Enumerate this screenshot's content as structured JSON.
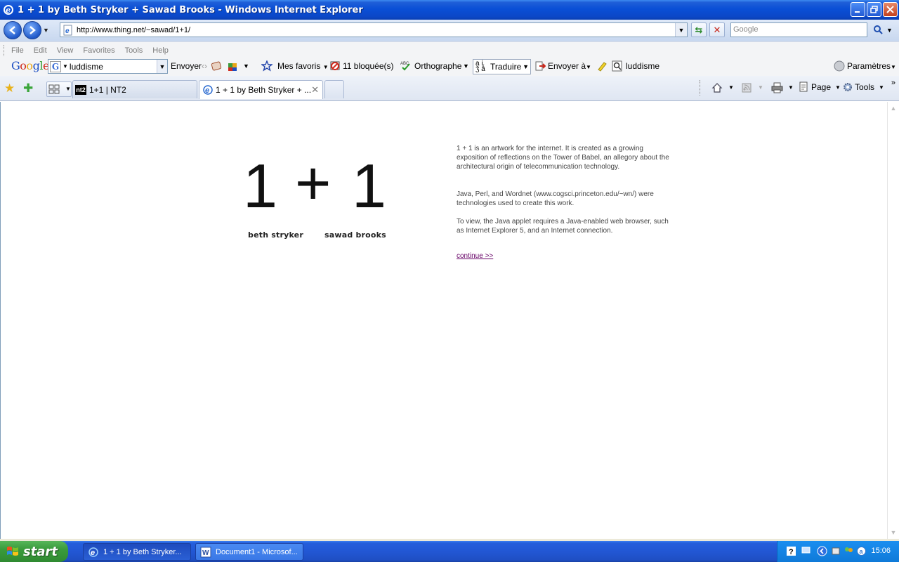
{
  "window": {
    "title": "1 + 1 by Beth Stryker + Sawad Brooks - Windows Internet Explorer"
  },
  "address_bar": {
    "url": "http://www.thing.net/~sawad/1+1/",
    "search_placeholder": "Google"
  },
  "menu": {
    "items": [
      "File",
      "Edit",
      "View",
      "Favorites",
      "Tools",
      "Help"
    ]
  },
  "google_toolbar": {
    "logo": "Google",
    "search_value": "luddisme",
    "send_label": "Envoyer",
    "favorites_label": "Mes favoris",
    "blocked_label": "11 bloquée(s)",
    "spell_label": "Orthographe",
    "translate_label": "Traduire",
    "send_to_label": "Envoyer à",
    "highlight_term": "luddisme",
    "settings_label": "Paramètres"
  },
  "tabs": {
    "items": [
      {
        "label": "1+1 | NT2",
        "active": false
      },
      {
        "label": "1 + 1 by Beth Stryker + ...",
        "active": true
      }
    ]
  },
  "command_bar": {
    "page_label": "Page",
    "tools_label": "Tools"
  },
  "page": {
    "title_one": "1",
    "title_plus": "+",
    "title_two": "1",
    "author_1": "beth stryker",
    "author_2": "sawad brooks",
    "paragraph_1": "1 + 1 is an artwork for the internet. It is created as a growing exposition of reflections on the Tower of Babel, an allegory about the architectural origin of telecommunication technology.",
    "paragraph_2": "Java, Perl, and Wordnet (www.cogsci.princeton.edu/~wn/) were technologies used to create this work.",
    "paragraph_3": "To view, the Java applet requires a Java-enabled web browser, such as Internet Explorer 5, and an Internet connection.",
    "continue_link": "continue >>",
    "link_color": "#660066"
  },
  "taskbar": {
    "start_label": "start",
    "tasks": [
      {
        "label": "1 + 1 by Beth Stryker..."
      },
      {
        "label": "Document1 - Microsof..."
      }
    ],
    "clock": "15:06"
  }
}
